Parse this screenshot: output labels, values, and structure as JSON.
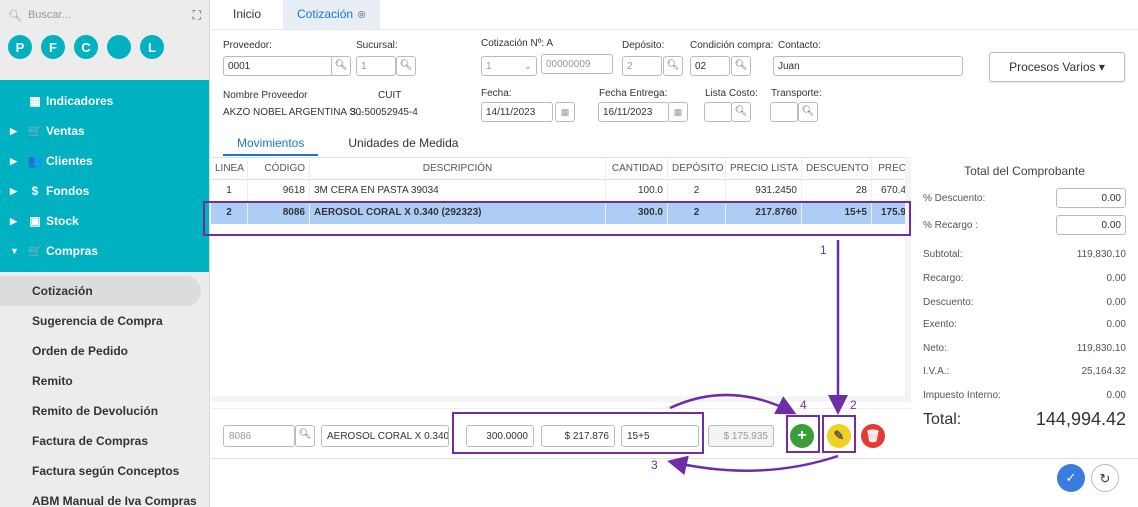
{
  "sidebar": {
    "search_placeholder": "Buscar...",
    "circles": [
      "P",
      "F",
      "C",
      "",
      "L"
    ],
    "nav": [
      {
        "icon": "▦",
        "label": "Indicadores",
        "chev": ""
      },
      {
        "icon": "🛒",
        "label": "Ventas",
        "chev": "▶"
      },
      {
        "icon": "👥",
        "label": "Clientes",
        "chev": "▶"
      },
      {
        "icon": "$",
        "label": "Fondos",
        "chev": "▶"
      },
      {
        "icon": "▣",
        "label": "Stock",
        "chev": "▶"
      },
      {
        "icon": "🛒",
        "label": "Compras",
        "chev": "▼"
      }
    ],
    "sub": [
      "Cotización",
      "Sugerencia de Compra",
      "Orden de Pedido",
      "Remito",
      "Remito de Devolución",
      "Factura de Compras",
      "Factura según Conceptos",
      "ABM Manual de Iva Compras"
    ]
  },
  "tabs": {
    "inicio": "Inicio",
    "cotizacion": "Cotización"
  },
  "form": {
    "proveedor_lbl": "Proveedor:",
    "proveedor": "0001",
    "sucursal_lbl": "Sucursal:",
    "sucursal": "1",
    "cotizacion_lbl": "Cotización Nº: A",
    "cot_letter": "1",
    "cot_num": "00000009",
    "deposito_lbl": "Depósito:",
    "deposito": "2",
    "condicion_lbl": "Condición compra:",
    "condicion": "02",
    "contacto_lbl": "Contacto:",
    "contacto": "Juan",
    "nombre_lbl": "Nombre Proveedor",
    "nombre": "AKZO NOBEL ARGENTINA S...",
    "cuit_lbl": "CUIT",
    "cuit": "30-50052945-4",
    "fecha_lbl": "Fecha:",
    "fecha": "14/11/2023",
    "entrega_lbl": "Fecha Entrega:",
    "entrega": "16/11/2023",
    "lista_lbl": "Lista Costo:",
    "transporte_lbl": "Transporte:",
    "procesos": "Procesos Varios ▾"
  },
  "subtabs": {
    "mov": "Movimientos",
    "um": "Unidades de Medida"
  },
  "grid": {
    "headers": [
      "LINEA",
      "CÓDIGO",
      "DESCRIPCIÓN",
      "CANTIDAD",
      "DEPÓSITO",
      "PRECIO LISTA",
      "DESCUENTO",
      "PREC"
    ],
    "rows": [
      [
        "1",
        "9618",
        "3M CERA EN PASTA 39034",
        "100.0",
        "2",
        "931.2450",
        "28",
        "670.4"
      ],
      [
        "2",
        "8086",
        "AEROSOL CORAL X 0.340 (292323)",
        "300.0",
        "2",
        "217.8760",
        "15+5",
        "175.9"
      ]
    ]
  },
  "totals": {
    "title": "Total del Comprobante",
    "desc_lbl": "% Descuento:",
    "desc": "0.00",
    "rec_lbl": "% Recargo :",
    "rec": "0.00",
    "subtotal_lbl": "Subtotal:",
    "subtotal": "119,830.10",
    "recargo_lbl": "Recargo:",
    "recargo": "0.00",
    "descuento_lbl": "Descuento:",
    "descuento": "0.00",
    "exento_lbl": "Exento:",
    "exento": "0.00",
    "neto_lbl": "Neto:",
    "neto": "119,830.10",
    "iva_lbl": "I.V.A.:",
    "iva": "25,164.32",
    "imp_lbl": "Impuesto Interno:",
    "imp": "0.00",
    "total_lbl": "Total:",
    "total": "144,994.42"
  },
  "editbar": {
    "codigo": "8086",
    "descripcion": "AEROSOL CORAL X 0.340",
    "cantidad": "300.0000",
    "precio": "$ 217.876",
    "descuento": "15+5",
    "subtotal": "$ 175.935"
  },
  "annotations": {
    "n1": "1",
    "n2": "2",
    "n3": "3",
    "n4": "4",
    "color": "#6f2da8"
  }
}
